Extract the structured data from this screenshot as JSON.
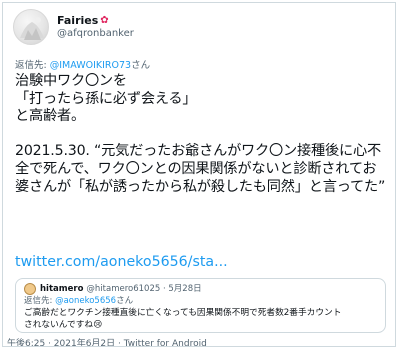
{
  "author": {
    "display_name": "Fairies",
    "badge_icon": "flower-icon",
    "handle": "@afqronbanker"
  },
  "reply_to": {
    "prefix": "返信先: ",
    "mention": "@IMAWOIKIRO73",
    "suffix": "さん"
  },
  "tweet": {
    "text": "治験中ワク〇ンを\n「打ったら孫に必ず会える」\nと高齢者。\n\n2021.5.30. “元気だったお爺さんがワク〇ン接種後に心不全で死んで、ワク〇ンとの因果関係がないと診断されてお婆さんが「私が誘ったから私が殺したも同然」と言ってた”",
    "link": "twitter.com/aoneko5656/sta..."
  },
  "quote": {
    "display_name": "hitamero",
    "handle_date": "@hitamero61025 · 5月28日",
    "reply_prefix": "返信先: ",
    "reply_mention": "@aoneko5656",
    "reply_suffix": "さん",
    "text_line1": "ご高齢だとワクチン接種直後に亡くなっても因果関係不明で死者数2番手カウント",
    "text_line2": "されないんですね😢"
  },
  "meta": {
    "timestamp": "午後6:25 · 2021年6月2日 · Twitter for Android"
  },
  "colors": {
    "link": "#1d9bf0",
    "secondary_text": "#536471",
    "border": "#cfd9de"
  }
}
